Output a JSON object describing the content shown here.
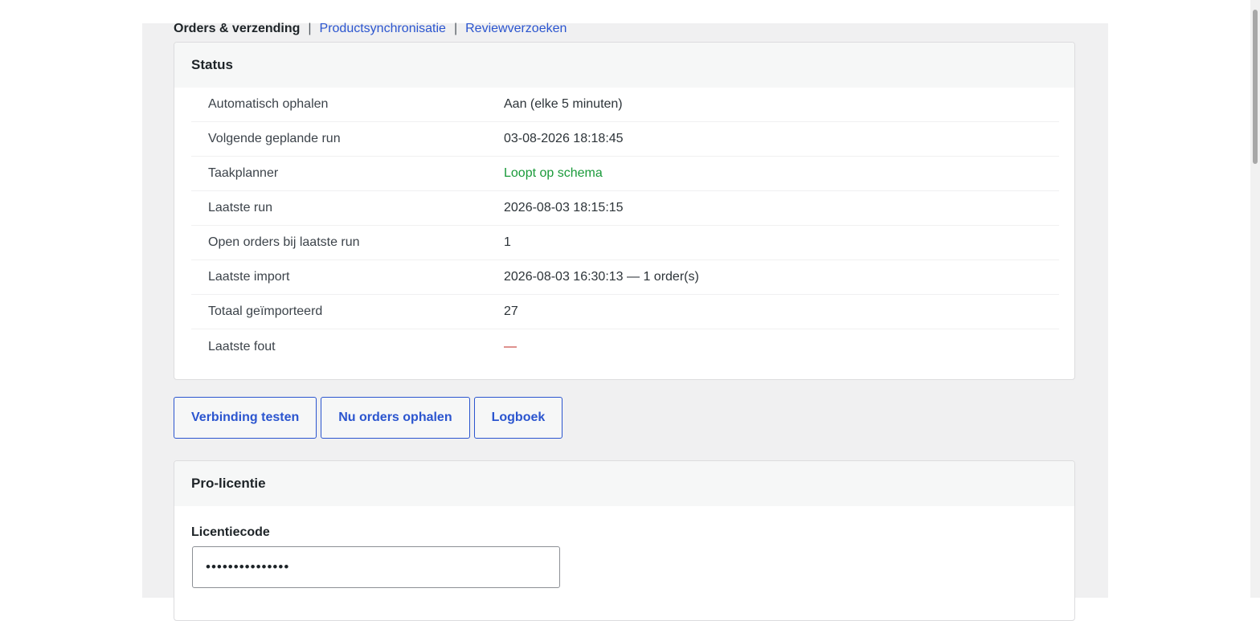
{
  "tabs": {
    "current": "Orders & verzending",
    "separator": "|",
    "links": [
      "Productsynchronisatie",
      "Reviewverzoeken"
    ]
  },
  "status": {
    "title": "Status",
    "rows": [
      {
        "label": "Automatisch ophalen",
        "value": "Aan (elke 5 minuten)"
      },
      {
        "label": "Volgende geplande run",
        "value": "03-08-2026 18:18:45"
      },
      {
        "label": "Taakplanner",
        "value": "Loopt op schema"
      },
      {
        "label": "Laatste run",
        "value": "2026-08-03 18:15:15"
      },
      {
        "label": "Open orders bij laatste run",
        "value": "1"
      },
      {
        "label": "Laatste import",
        "value": "2026-08-03 16:30:13 — 1 order(s)"
      },
      {
        "label": "Totaal geïmporteerd",
        "value": "27"
      },
      {
        "label": "Laatste fout",
        "value": "—"
      }
    ]
  },
  "actions": {
    "test_connection": "Verbinding testen",
    "fetch_orders": "Nu orders ophalen",
    "log": "Logboek"
  },
  "license": {
    "title": "Pro-licentie",
    "field_label": "Licentiecode",
    "value": "•••••••••••••••"
  },
  "colors": {
    "link": "#2b55cf",
    "ok": "#1a9a3a",
    "error": "#c0312b"
  }
}
